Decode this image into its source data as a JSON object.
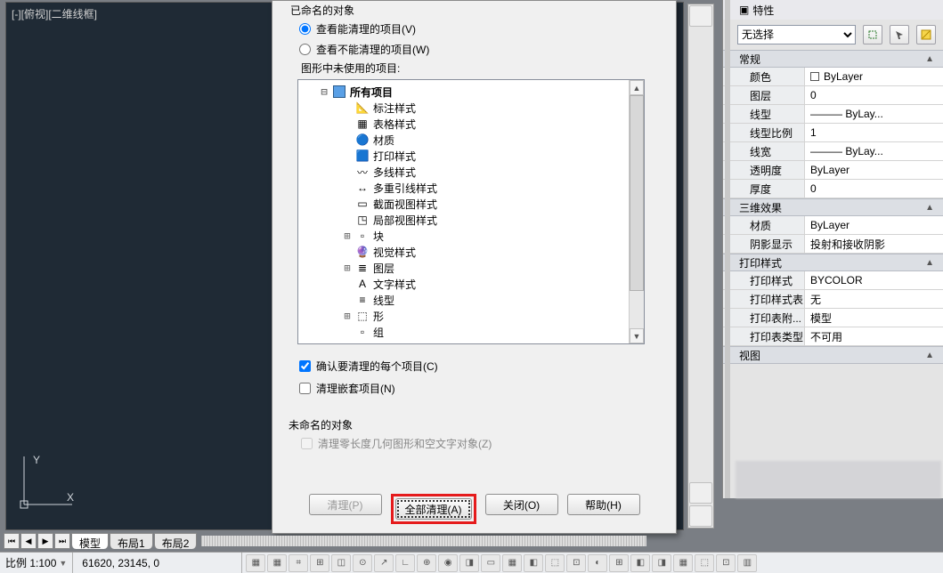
{
  "viewport": {
    "label": "[-][俯视][二维线框]"
  },
  "dialog": {
    "named_section": "已命名的对象",
    "radio_view_purgable": "查看能清理的项目(V)",
    "radio_view_unpurgable": "查看不能清理的项目(W)",
    "unused_label": "图形中未使用的项目:",
    "tree": {
      "root": "所有项目",
      "items": [
        "标注样式",
        "表格样式",
        "材质",
        "打印样式",
        "多线样式",
        "多重引线样式",
        "截面视图样式",
        "局部视图样式",
        "块",
        "视觉样式",
        "图层",
        "文字样式",
        "线型",
        "形",
        "组"
      ]
    },
    "confirm_each": "确认要清理的每个项目(C)",
    "purge_nested": "清理嵌套项目(N)",
    "unnamed_label": "未命名的对象",
    "purge_zero": "清理零长度几何图形和空文字对象(Z)",
    "buttons": {
      "purge": "清理(P)",
      "purge_all": "全部清理(A)",
      "close": "关闭(O)",
      "help": "帮助(H)"
    }
  },
  "properties": {
    "title": "特性",
    "selection": "无选择",
    "groups": {
      "general": {
        "label": "常规",
        "rows": {
          "color": {
            "name": "颜色",
            "value": "ByLayer"
          },
          "layer": {
            "name": "图层",
            "value": "0"
          },
          "linetype": {
            "name": "线型",
            "value": "——— ByLay..."
          },
          "ltscale": {
            "name": "线型比例",
            "value": "1"
          },
          "lineweight": {
            "name": "线宽",
            "value": "——— ByLay..."
          },
          "transparency": {
            "name": "透明度",
            "value": "ByLayer"
          },
          "thickness": {
            "name": "厚度",
            "value": "0"
          }
        }
      },
      "effect3d": {
        "label": "三维效果",
        "rows": {
          "material": {
            "name": "材质",
            "value": "ByLayer"
          },
          "shadow": {
            "name": "阴影显示",
            "value": "投射和接收阴影"
          }
        }
      },
      "plotstyle": {
        "label": "打印样式",
        "rows": {
          "pstyle": {
            "name": "打印样式",
            "value": "BYCOLOR"
          },
          "pstyletable": {
            "name": "打印样式表",
            "value": "无"
          },
          "pstyleattach": {
            "name": "打印表附...",
            "value": "模型"
          },
          "pstyletype": {
            "name": "打印表类型",
            "value": "不可用"
          }
        }
      },
      "view": {
        "label": "视图"
      }
    }
  },
  "tabs": {
    "model": "模型",
    "layout1": "布局1",
    "layout2": "布局2"
  },
  "status": {
    "scale_label": "比例 1:100",
    "coords": "61620, 23145, 0"
  },
  "colors": {
    "highlight": "#e51b1c"
  }
}
